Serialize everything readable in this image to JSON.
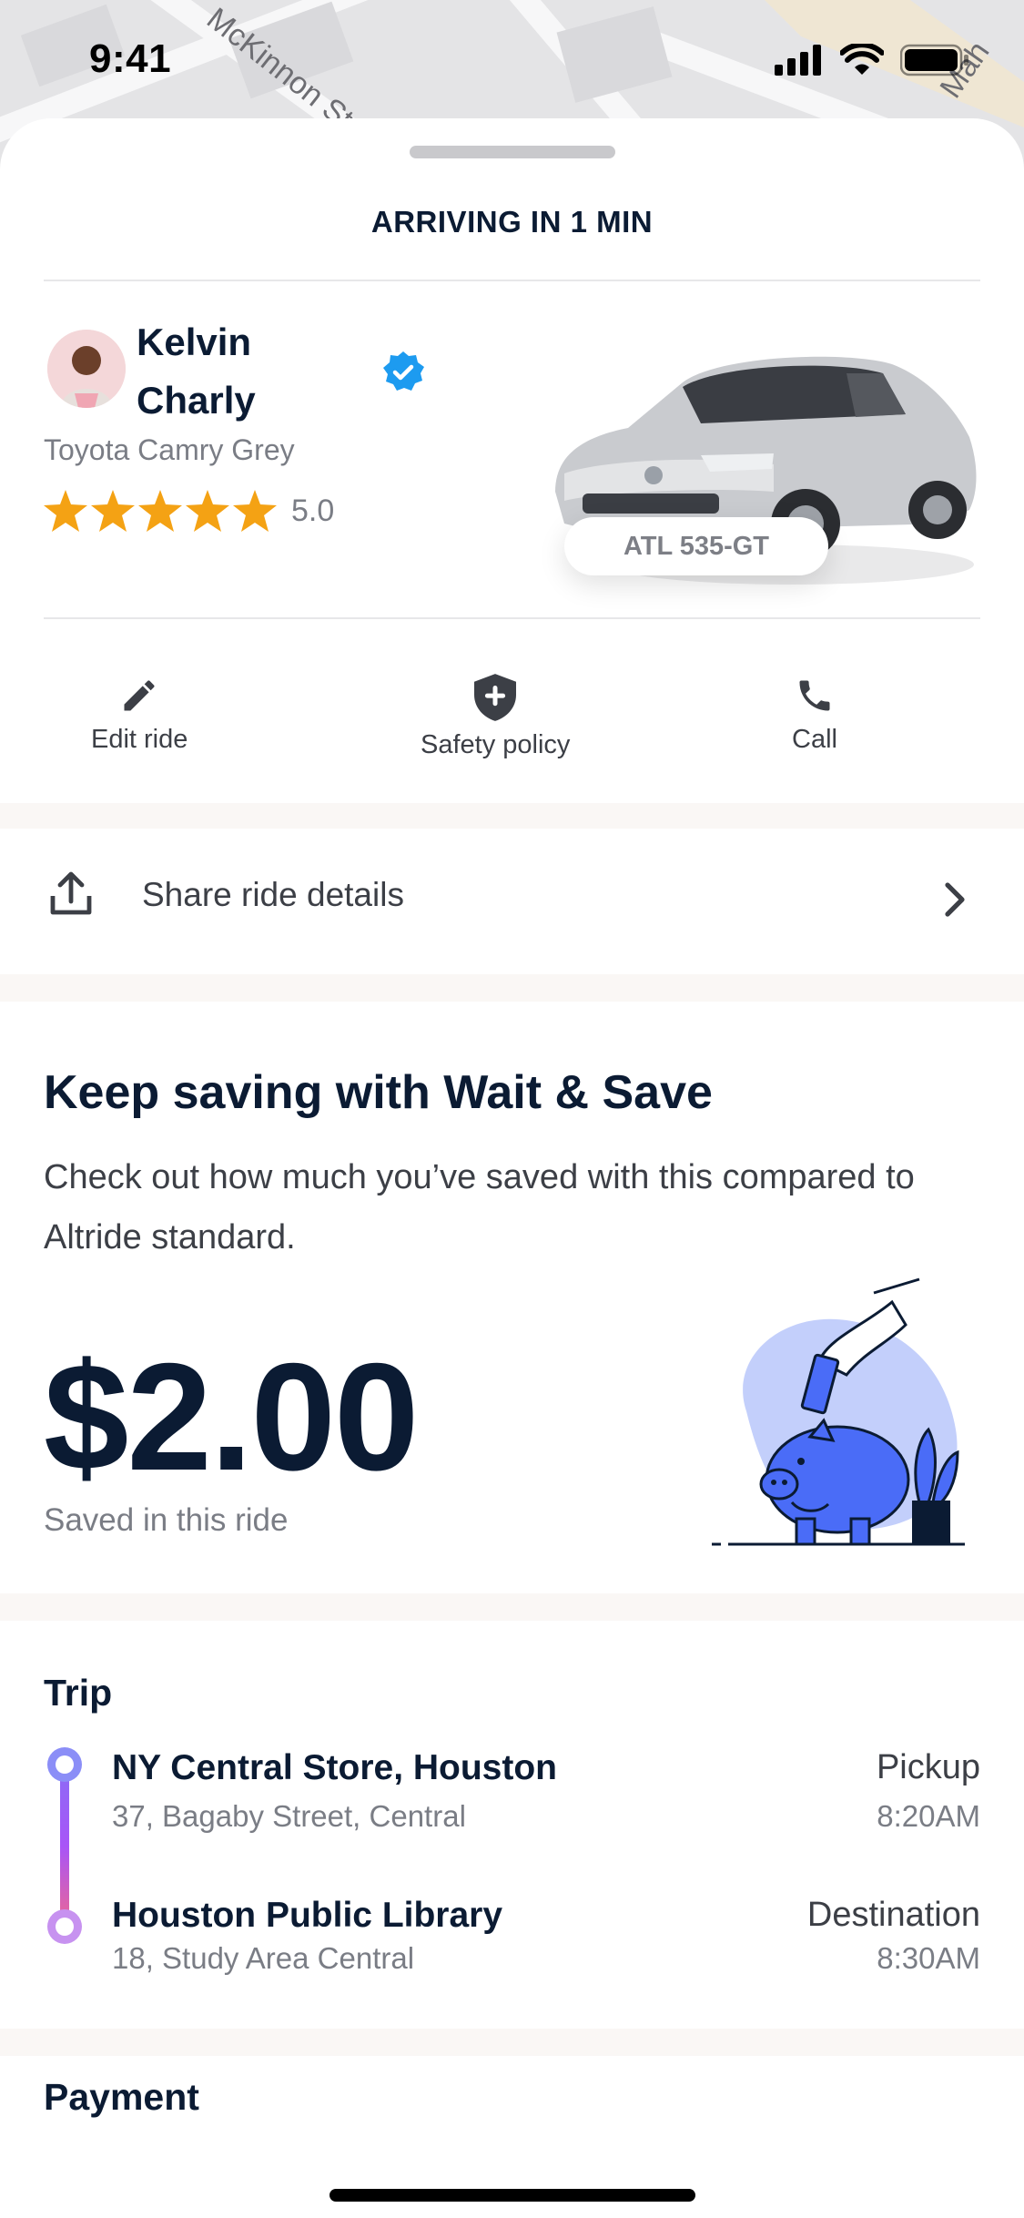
{
  "status_bar": {
    "time": "9:41"
  },
  "map": {
    "street_label_1": "McKinnon St",
    "street_label_2": "Mah"
  },
  "sheet": {
    "arriving_text": "ARRIVING IN 1 MIN",
    "driver": {
      "first_name": "Kelvin",
      "last_name": "Charly",
      "car_model": "Toyota Camry Grey",
      "rating": "5.0",
      "star_count": 5,
      "plate": "ATL 535-GT"
    },
    "actions": [
      {
        "label": "Edit ride",
        "icon": "pencil-icon"
      },
      {
        "label": "Safety policy",
        "icon": "shield-plus-icon"
      },
      {
        "label": "Call",
        "icon": "phone-icon"
      }
    ],
    "share": {
      "label": "Share ride details"
    },
    "wait_save": {
      "title": "Keep saving with Wait & Save",
      "description": "Check out how much you’ve saved with this compared to Altride standard.",
      "amount": "$2.00",
      "amount_label": "Saved in this ride"
    },
    "trip": {
      "title": "Trip",
      "stops": [
        {
          "name": "NY Central Store, Houston",
          "address": "37, Bagaby Street, Central",
          "role": "Pickup",
          "time": "8:20AM"
        },
        {
          "name": "Houston Public Library",
          "address": "18, Study Area Central",
          "role": "Destination",
          "time": "8:30AM"
        }
      ]
    },
    "payment": {
      "title": "Payment"
    }
  },
  "colors": {
    "accent_blue": "#4a6cf7",
    "star": "#f4a214",
    "verified": "#1d9bf0",
    "text_dark": "#0b1b33"
  }
}
